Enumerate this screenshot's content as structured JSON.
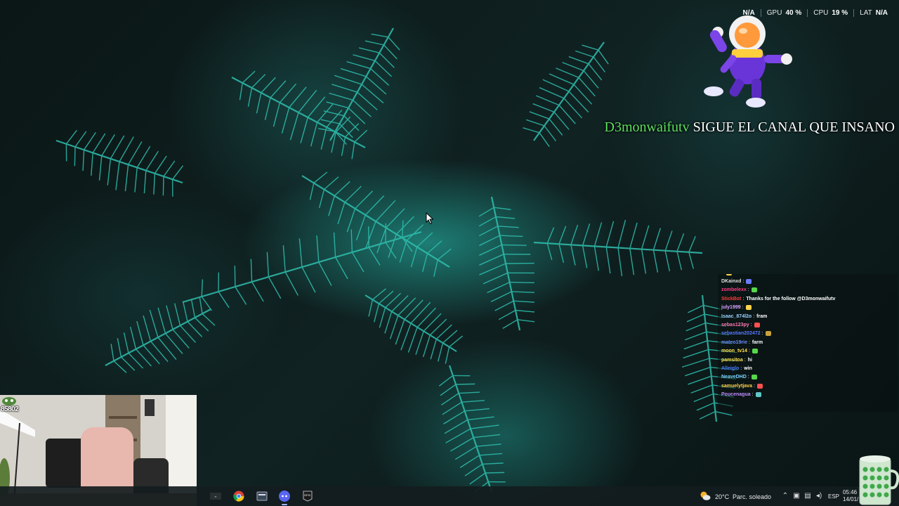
{
  "stats": [
    {
      "label": "",
      "value": "N/A"
    },
    {
      "label": "GPU",
      "value": "40 %"
    },
    {
      "label": "CPU",
      "value": "19 %"
    },
    {
      "label": "LAT",
      "value": "N/A"
    }
  ],
  "alert": {
    "username": "D3monwaifutv",
    "message": "SIGUE EL CANAL QUE INSANO"
  },
  "chat": [
    {
      "user": "",
      "color": "#9aa8ff",
      "msg": "",
      "emote": "#ffd34d"
    },
    {
      "user": "DKainxd",
      "color": "#e0e0e0",
      "msg": "",
      "emote": "#6a7cff"
    },
    {
      "user": "zombelexx",
      "color": "#ff3b8a",
      "msg": "",
      "emote": "#55d84a"
    },
    {
      "user": "StickBot",
      "color": "#ff3b3b",
      "msg": "Thanks for the follow @D3monwaifutv",
      "emote": ""
    },
    {
      "user": "july1999",
      "color": "#d9a4ff",
      "msg": "",
      "emote": "#ffd34d"
    },
    {
      "user": "Isaac_874l2o",
      "color": "#9ad0ff",
      "msg": "fram",
      "emote": ""
    },
    {
      "user": "sebas123py",
      "color": "#ff7ab6",
      "msg": "",
      "emote": "#ff5050"
    },
    {
      "user": "sebastian202472",
      "color": "#5a78ff",
      "msg": "",
      "emote": "#c9a23a"
    },
    {
      "user": "mateo19rie",
      "color": "#6b8cff",
      "msg": "farm",
      "emote": ""
    },
    {
      "user": "moon_tv14",
      "color": "#ffe04a",
      "msg": "",
      "emote": "#55d84a"
    },
    {
      "user": "pamsitoa",
      "color": "#ffe04a",
      "msg": "hi",
      "emote": ""
    },
    {
      "user": "Alleiglo",
      "color": "#4a7cff",
      "msg": "win",
      "emote": ""
    },
    {
      "user": "NeaveDHD",
      "color": "#7ad4ff",
      "msg": "",
      "emote": "#55d84a"
    },
    {
      "user": "samuelytjava",
      "color": "#ffd34d",
      "msg": "",
      "emote": "#ff5050"
    },
    {
      "user": "Poucenagua",
      "color": "#c08aff",
      "msg": "",
      "emote": "#5fc7c7"
    }
  ],
  "webcam": {
    "counter": "85802"
  },
  "taskbar": {
    "weather_temp": "20°C",
    "weather_desc": "Parc. soleado",
    "language": "ESP",
    "time": "05:46",
    "date": "14/01/"
  },
  "colors": {
    "taskbar": "#141c1e",
    "alert_name": "#5fe05f",
    "fern": "#2ec9b8"
  }
}
